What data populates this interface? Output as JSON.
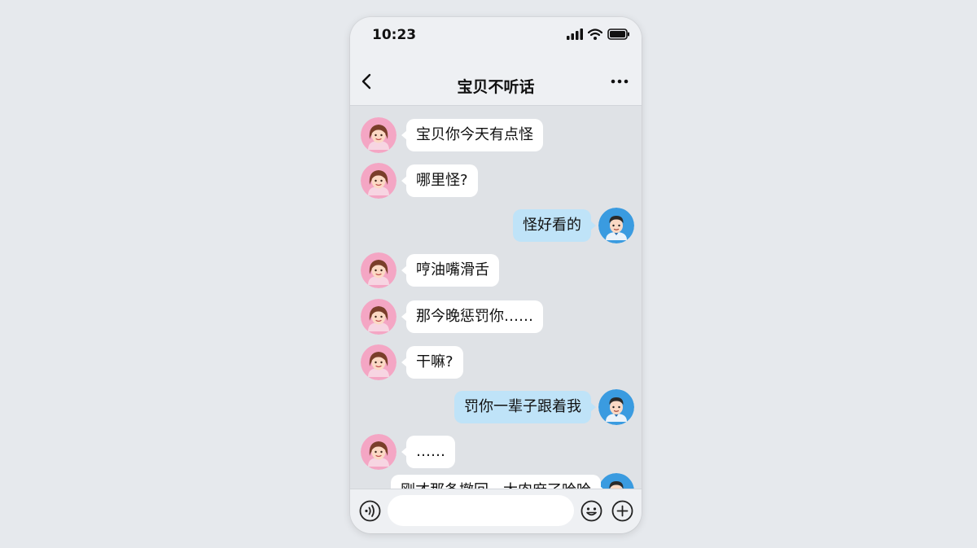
{
  "status_bar": {
    "time": "10:23"
  },
  "header": {
    "title": "宝贝不听话",
    "back_icon": "chevron-left-icon",
    "more_icon": "more-dots-icon"
  },
  "messages": [
    {
      "side": "left",
      "text": "宝贝你今天有点怪"
    },
    {
      "side": "left",
      "text": "哪里怪?"
    },
    {
      "side": "right",
      "text": "怪好看的"
    },
    {
      "side": "left",
      "text": "哼油嘴滑舌"
    },
    {
      "side": "left",
      "text": "那今晚惩罚你……"
    },
    {
      "side": "left",
      "text": "干嘛?"
    },
    {
      "side": "right",
      "text": "罚你一辈子跟着我"
    },
    {
      "side": "left",
      "text": "……"
    },
    {
      "side": "right",
      "text": "刚才那条撤回，太肉麻了哈哈"
    }
  ],
  "input_bar": {
    "placeholder": "",
    "icons": [
      "voice-icon",
      "emoji-icon",
      "plus-icon"
    ]
  },
  "colors": {
    "incoming_bubble": "#ffffff",
    "outgoing_bubble": "#bfe3f8",
    "background": "#dfe2e6"
  }
}
